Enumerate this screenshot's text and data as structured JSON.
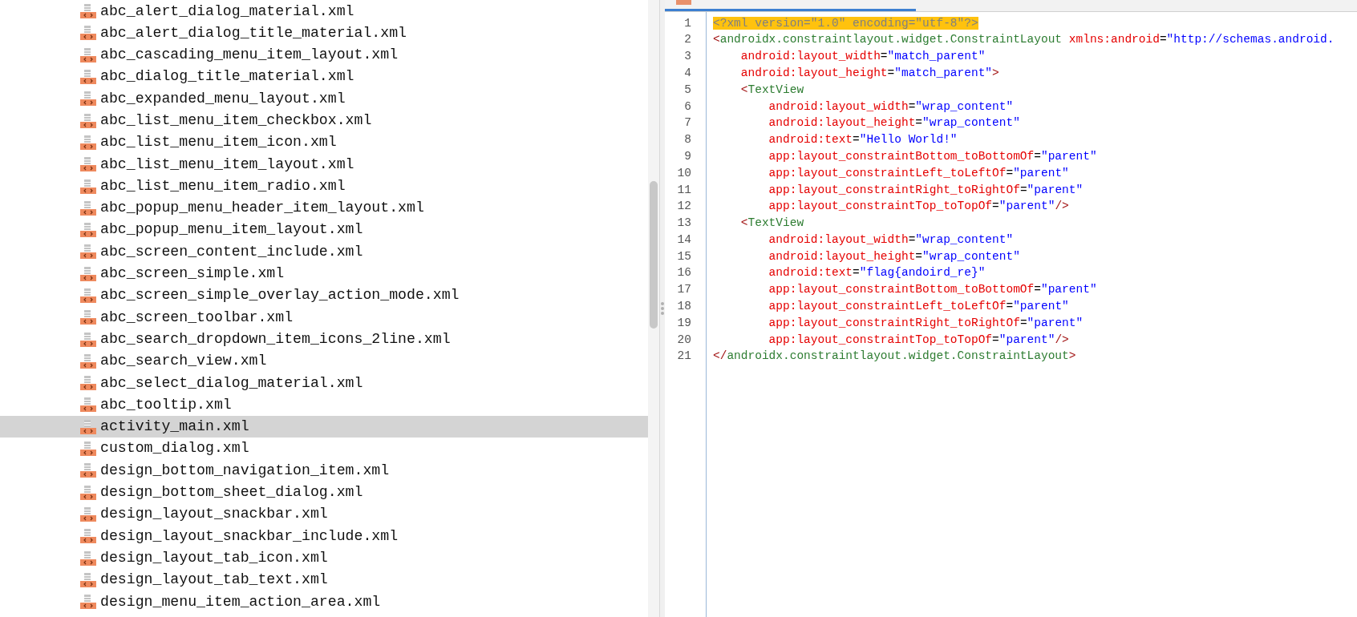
{
  "file_list": {
    "items": [
      {
        "name": "abc_alert_dialog_material.xml",
        "selected": false
      },
      {
        "name": "abc_alert_dialog_title_material.xml",
        "selected": false
      },
      {
        "name": "abc_cascading_menu_item_layout.xml",
        "selected": false
      },
      {
        "name": "abc_dialog_title_material.xml",
        "selected": false
      },
      {
        "name": "abc_expanded_menu_layout.xml",
        "selected": false
      },
      {
        "name": "abc_list_menu_item_checkbox.xml",
        "selected": false
      },
      {
        "name": "abc_list_menu_item_icon.xml",
        "selected": false
      },
      {
        "name": "abc_list_menu_item_layout.xml",
        "selected": false
      },
      {
        "name": "abc_list_menu_item_radio.xml",
        "selected": false
      },
      {
        "name": "abc_popup_menu_header_item_layout.xml",
        "selected": false
      },
      {
        "name": "abc_popup_menu_item_layout.xml",
        "selected": false
      },
      {
        "name": "abc_screen_content_include.xml",
        "selected": false
      },
      {
        "name": "abc_screen_simple.xml",
        "selected": false
      },
      {
        "name": "abc_screen_simple_overlay_action_mode.xml",
        "selected": false
      },
      {
        "name": "abc_screen_toolbar.xml",
        "selected": false
      },
      {
        "name": "abc_search_dropdown_item_icons_2line.xml",
        "selected": false
      },
      {
        "name": "abc_search_view.xml",
        "selected": false
      },
      {
        "name": "abc_select_dialog_material.xml",
        "selected": false
      },
      {
        "name": "abc_tooltip.xml",
        "selected": false
      },
      {
        "name": "activity_main.xml",
        "selected": true
      },
      {
        "name": "custom_dialog.xml",
        "selected": false
      },
      {
        "name": "design_bottom_navigation_item.xml",
        "selected": false
      },
      {
        "name": "design_bottom_sheet_dialog.xml",
        "selected": false
      },
      {
        "name": "design_layout_snackbar.xml",
        "selected": false
      },
      {
        "name": "design_layout_snackbar_include.xml",
        "selected": false
      },
      {
        "name": "design_layout_tab_icon.xml",
        "selected": false
      },
      {
        "name": "design_layout_tab_text.xml",
        "selected": false
      },
      {
        "name": "design_menu_item_action_area.xml",
        "selected": false
      }
    ]
  },
  "editor": {
    "lines": [
      {
        "number": "1",
        "tokens": [
          {
            "kind": "decl",
            "text": "<?xml version=\"1.0\" encoding=\"utf-8\"?>"
          }
        ]
      },
      {
        "number": "2",
        "tokens": [
          {
            "kind": "punct",
            "text": "<"
          },
          {
            "kind": "tag",
            "text": "androidx.constraintlayout.widget.ConstraintLayout "
          },
          {
            "kind": "attr",
            "text": "xmlns:android"
          },
          {
            "kind": "plain",
            "text": "="
          },
          {
            "kind": "value",
            "text": "\"http://schemas.android."
          }
        ]
      },
      {
        "number": "3",
        "tokens": [
          {
            "kind": "attr",
            "text": "    android:layout_width"
          },
          {
            "kind": "plain",
            "text": "="
          },
          {
            "kind": "value",
            "text": "\"match_parent\""
          }
        ]
      },
      {
        "number": "4",
        "tokens": [
          {
            "kind": "attr",
            "text": "    android:layout_height"
          },
          {
            "kind": "plain",
            "text": "="
          },
          {
            "kind": "value",
            "text": "\"match_parent\""
          },
          {
            "kind": "punct",
            "text": ">"
          }
        ]
      },
      {
        "number": "5",
        "tokens": [
          {
            "kind": "punct",
            "text": "    <"
          },
          {
            "kind": "tag",
            "text": "TextView"
          }
        ]
      },
      {
        "number": "6",
        "tokens": [
          {
            "kind": "attr",
            "text": "        android:layout_width"
          },
          {
            "kind": "plain",
            "text": "="
          },
          {
            "kind": "value",
            "text": "\"wrap_content\""
          }
        ]
      },
      {
        "number": "7",
        "tokens": [
          {
            "kind": "attr",
            "text": "        android:layout_height"
          },
          {
            "kind": "plain",
            "text": "="
          },
          {
            "kind": "value",
            "text": "\"wrap_content\""
          }
        ]
      },
      {
        "number": "8",
        "tokens": [
          {
            "kind": "attr",
            "text": "        android:text"
          },
          {
            "kind": "plain",
            "text": "="
          },
          {
            "kind": "value",
            "text": "\"Hello World!\""
          }
        ]
      },
      {
        "number": "9",
        "tokens": [
          {
            "kind": "attr",
            "text": "        app:layout_constraintBottom_toBottomOf"
          },
          {
            "kind": "plain",
            "text": "="
          },
          {
            "kind": "value",
            "text": "\"parent\""
          }
        ]
      },
      {
        "number": "10",
        "tokens": [
          {
            "kind": "attr",
            "text": "        app:layout_constraintLeft_toLeftOf"
          },
          {
            "kind": "plain",
            "text": "="
          },
          {
            "kind": "value",
            "text": "\"parent\""
          }
        ]
      },
      {
        "number": "11",
        "tokens": [
          {
            "kind": "attr",
            "text": "        app:layout_constraintRight_toRightOf"
          },
          {
            "kind": "plain",
            "text": "="
          },
          {
            "kind": "value",
            "text": "\"parent\""
          }
        ]
      },
      {
        "number": "12",
        "tokens": [
          {
            "kind": "attr",
            "text": "        app:layout_constraintTop_toTopOf"
          },
          {
            "kind": "plain",
            "text": "="
          },
          {
            "kind": "value",
            "text": "\"parent\""
          },
          {
            "kind": "punct",
            "text": "/>"
          }
        ]
      },
      {
        "number": "13",
        "tokens": [
          {
            "kind": "punct",
            "text": "    <"
          },
          {
            "kind": "tag",
            "text": "TextView"
          }
        ]
      },
      {
        "number": "14",
        "tokens": [
          {
            "kind": "attr",
            "text": "        android:layout_width"
          },
          {
            "kind": "plain",
            "text": "="
          },
          {
            "kind": "value",
            "text": "\"wrap_content\""
          }
        ]
      },
      {
        "number": "15",
        "tokens": [
          {
            "kind": "attr",
            "text": "        android:layout_height"
          },
          {
            "kind": "plain",
            "text": "="
          },
          {
            "kind": "value",
            "text": "\"wrap_content\""
          }
        ]
      },
      {
        "number": "16",
        "tokens": [
          {
            "kind": "attr",
            "text": "        android:text"
          },
          {
            "kind": "plain",
            "text": "="
          },
          {
            "kind": "value",
            "text": "\"flag{andoird_re}\""
          }
        ]
      },
      {
        "number": "17",
        "tokens": [
          {
            "kind": "attr",
            "text": "        app:layout_constraintBottom_toBottomOf"
          },
          {
            "kind": "plain",
            "text": "="
          },
          {
            "kind": "value",
            "text": "\"parent\""
          }
        ]
      },
      {
        "number": "18",
        "tokens": [
          {
            "kind": "attr",
            "text": "        app:layout_constraintLeft_toLeftOf"
          },
          {
            "kind": "plain",
            "text": "="
          },
          {
            "kind": "value",
            "text": "\"parent\""
          }
        ]
      },
      {
        "number": "19",
        "tokens": [
          {
            "kind": "attr",
            "text": "        app:layout_constraintRight_toRightOf"
          },
          {
            "kind": "plain",
            "text": "="
          },
          {
            "kind": "value",
            "text": "\"parent\""
          }
        ]
      },
      {
        "number": "20",
        "tokens": [
          {
            "kind": "attr",
            "text": "        app:layout_constraintTop_toTopOf"
          },
          {
            "kind": "plain",
            "text": "="
          },
          {
            "kind": "value",
            "text": "\"parent\""
          },
          {
            "kind": "punct",
            "text": "/>"
          }
        ]
      },
      {
        "number": "21",
        "tokens": [
          {
            "kind": "punct",
            "text": "</"
          },
          {
            "kind": "tag",
            "text": "androidx.constraintlayout.widget.ConstraintLayout"
          },
          {
            "kind": "punct",
            "text": ">"
          }
        ]
      }
    ]
  }
}
